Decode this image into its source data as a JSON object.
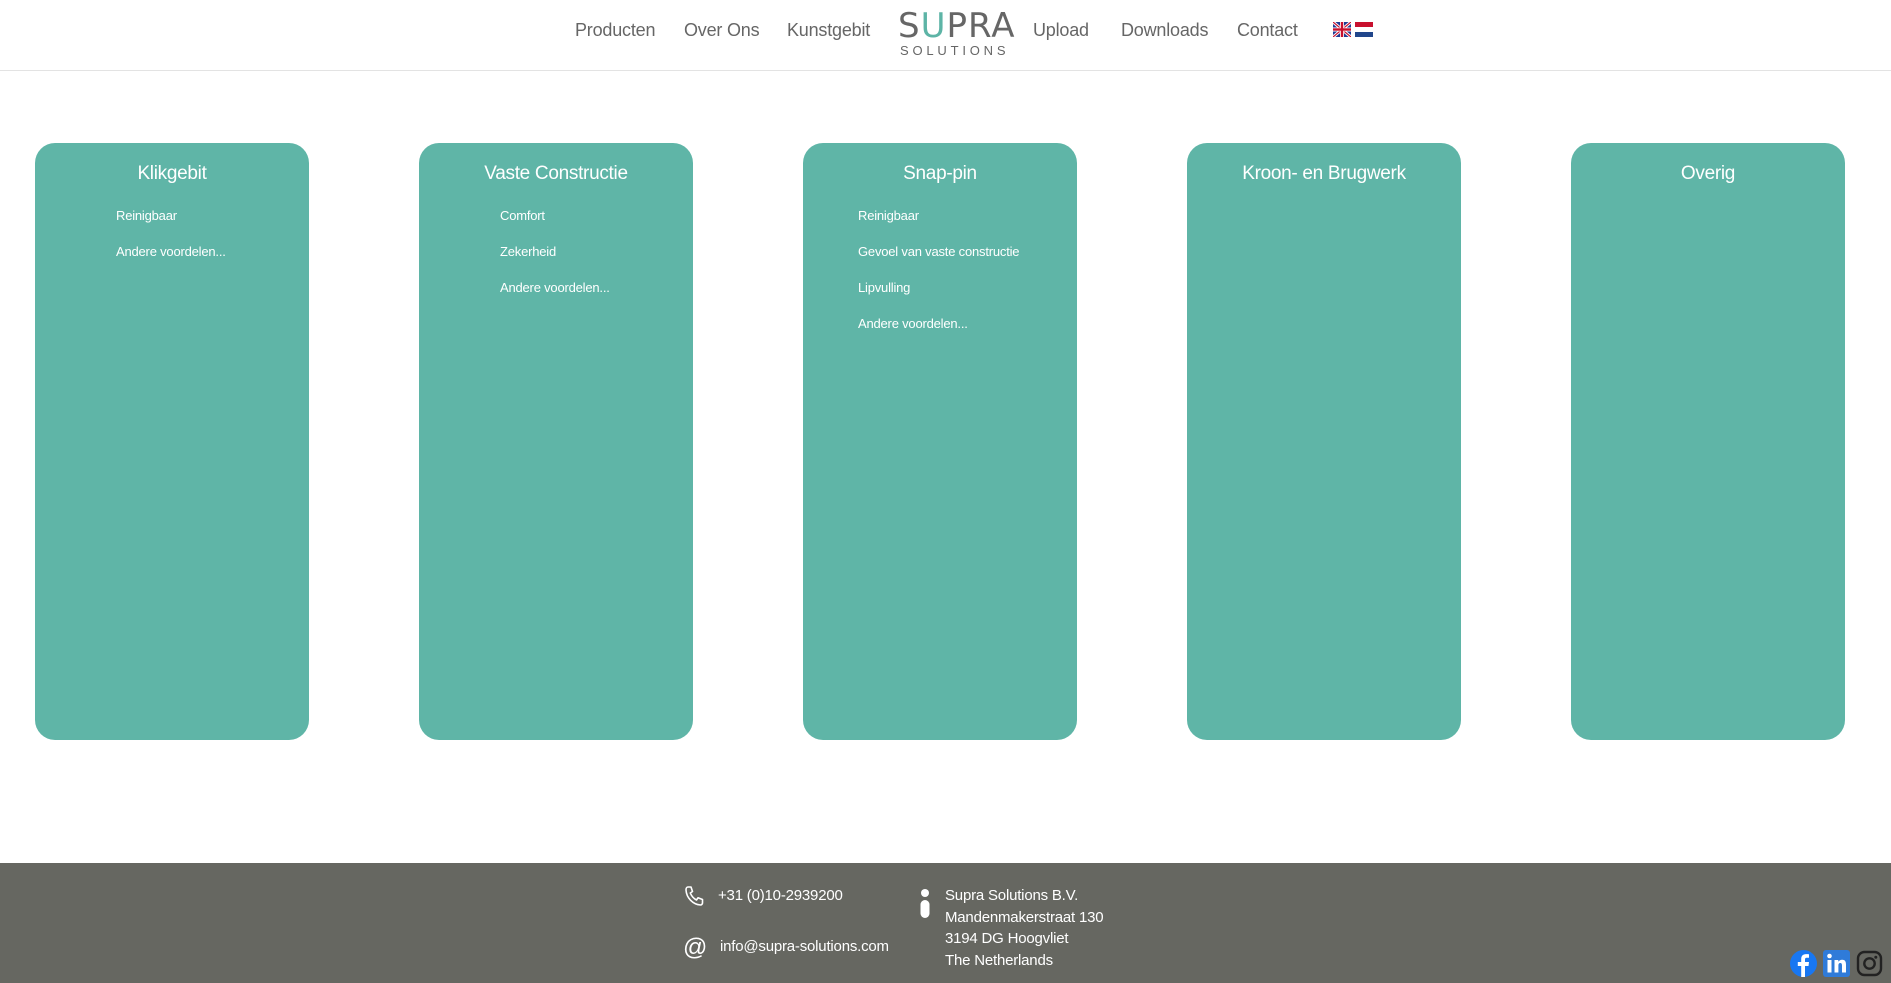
{
  "nav": {
    "items": [
      "Producten",
      "Over Ons",
      "Kunstgebit",
      "Upload",
      "Downloads",
      "Contact"
    ]
  },
  "logo": {
    "main_prefix": "S",
    "main_accent": "U",
    "main_suffix": "PRA",
    "sub": "SOLUTIONS"
  },
  "languages": [
    "English flag",
    "Dutch flag"
  ],
  "cards": [
    {
      "title": "Klikgebit",
      "items": [
        "Reinigbaar",
        "Andere voordelen..."
      ]
    },
    {
      "title": "Vaste Constructie",
      "items": [
        "Comfort",
        "Zekerheid",
        "Andere voordelen..."
      ]
    },
    {
      "title": "Snap-pin",
      "items": [
        "Reinigbaar",
        "Gevoel van vaste constructie",
        "Lipvulling",
        "Andere voordelen..."
      ]
    },
    {
      "title": "Kroon- en Brugwerk",
      "items": []
    },
    {
      "title": "Overig",
      "items": []
    }
  ],
  "footer": {
    "phone": "+31 (0)10-2939200",
    "email": "info@supra-solutions.com",
    "address": [
      "Supra Solutions B.V.",
      "Mandenmakerstraat 130",
      "3194 DG Hoogvliet",
      "The Netherlands"
    ]
  },
  "colors": {
    "accent": "#5fb5a7",
    "footer_bg": "#666761",
    "facebook": "#1877f2",
    "linkedin": "#2f7bd9"
  },
  "icons": [
    "phone-icon",
    "at-icon",
    "info-icon",
    "facebook-icon",
    "linkedin-icon",
    "instagram-icon"
  ]
}
